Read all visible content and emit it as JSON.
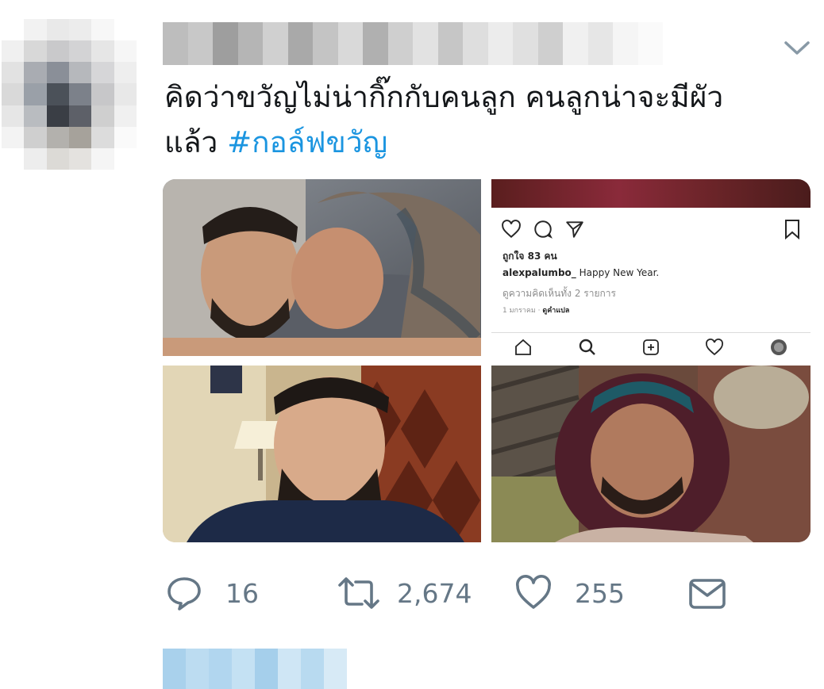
{
  "tweet": {
    "text_line1": "คิดว่าขวัญไม่น่ากิ๊กกับคนลูก คนลูกน่าจะมีผัว",
    "text_line2_prefix": "แล้ว ",
    "hashtag": "#กอล์ฟขวัญ"
  },
  "instagram_post": {
    "likes": "ถูกใจ 83 คน",
    "username": "alexpalumbo_",
    "caption": " Happy New Year.",
    "comments_link": "ดูความคิดเห็นทั้ง 2 รายการ",
    "date": "1 มกราคม",
    "separator": " · ",
    "translate": "ดูคำแปล"
  },
  "actions": {
    "reply_count": "16",
    "retweet_count": "2,674",
    "like_count": "255"
  },
  "icons": {
    "caret": "chevron-down-icon",
    "reply": "reply-icon",
    "retweet": "retweet-icon",
    "like": "heart-icon",
    "dm": "envelope-icon"
  },
  "colors": {
    "text": "#14171a",
    "hashtag": "#1b95e0",
    "action_gray": "#657786"
  }
}
